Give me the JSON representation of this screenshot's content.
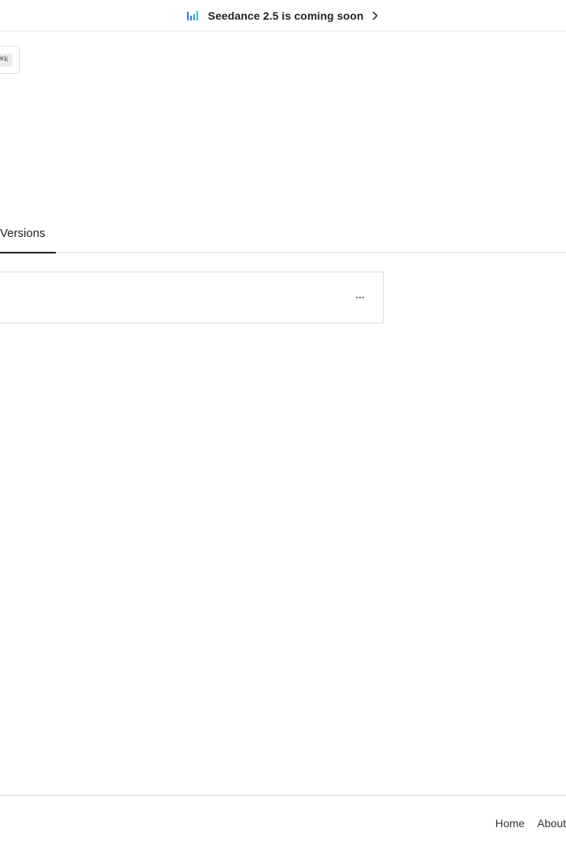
{
  "banner": {
    "text": "Seedance 2.5 is coming soon",
    "icon": "bars-chart-icon",
    "chevron_icon": "chevron-right-icon"
  },
  "search": {
    "shortcut": "⌘k"
  },
  "tabs": [
    {
      "label": "Versions",
      "active": true
    }
  ],
  "version_card": {
    "more_icon": "ellipsis-icon"
  },
  "footer": {
    "links": [
      {
        "label": "Home"
      },
      {
        "label": "About"
      }
    ]
  }
}
